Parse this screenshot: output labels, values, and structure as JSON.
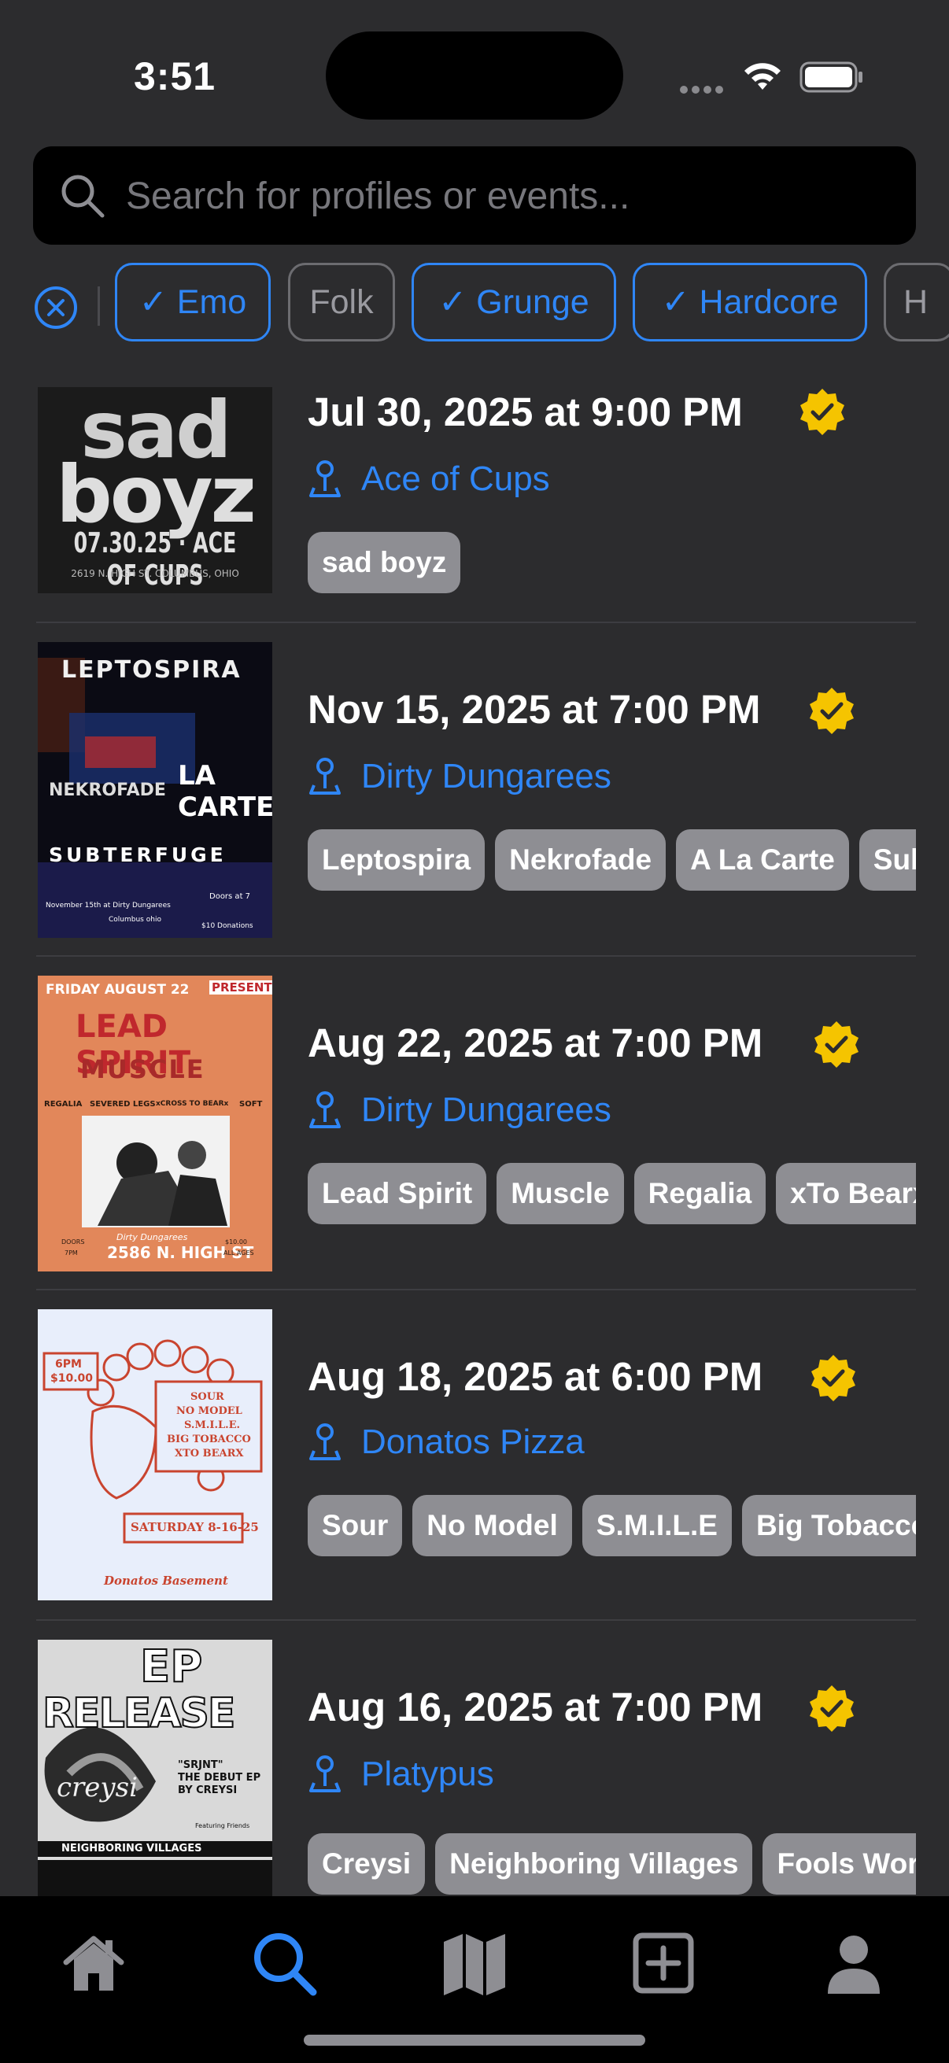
{
  "status_bar": {
    "time": "3:51"
  },
  "search": {
    "placeholder": "Search for profiles or events..."
  },
  "filters": {
    "chips": [
      {
        "label": "✓ Emo",
        "selected": true
      },
      {
        "label": "Folk",
        "selected": false
      },
      {
        "label": "✓ Grunge",
        "selected": true
      },
      {
        "label": "✓ Hardcore",
        "selected": true
      },
      {
        "label": "H",
        "selected": false
      }
    ]
  },
  "events": [
    {
      "date": "Jul 30, 2025 at 9:00 PM",
      "venue": "Ace of Cups",
      "verified": true,
      "performers": [
        "sad boyz"
      ],
      "poster_text": [
        "sad",
        "boyz",
        "07.30.25 · ACE OF CUPS",
        "2619 N. HIGH ST. COLUMBUS, OHIO"
      ]
    },
    {
      "date": "Nov 15, 2025 at 7:00 PM",
      "venue": "Dirty Dungarees",
      "verified": true,
      "performers": [
        "Leptospira",
        "Nekrofade",
        "A La Carte",
        "Subterfuge"
      ],
      "poster_text": [
        "LEPTOSPIRA",
        "NEKROFADE",
        "LA CARTE",
        "SUBTERFUGE",
        "November 15th at Dirty Dungarees",
        "Doors at 7",
        "Columbus ohio",
        "$10 Donations"
      ]
    },
    {
      "date": "Aug 22, 2025 at 7:00 PM",
      "venue": "Dirty Dungarees",
      "verified": true,
      "performers": [
        "Lead Spirit",
        "Muscle",
        "Regalia",
        "xTo Bearx"
      ],
      "poster_text": [
        "FRIDAY AUGUST 22",
        "PRESENTS",
        "LEAD SPIRIT",
        "MUSCLE",
        "REGALIA",
        "SEVERED LEGS",
        "xCROSS TO BEARx",
        "SOFT",
        "DOORS",
        "7PM",
        "Dirty Dungarees",
        "2586 N. HIGH ST",
        "$10.00",
        "ALL AGES"
      ]
    },
    {
      "date": "Aug 18, 2025 at 6:00 PM",
      "venue": "Donatos Pizza",
      "verified": true,
      "performers": [
        "Sour",
        "No Model",
        "S.M.I.L.E",
        "Big Tobacco"
      ],
      "poster_text": [
        "6PM",
        "$10.00",
        "SOUR",
        "NO MODEL",
        "S.M.I.L.E.",
        "BIG TOBACCO",
        "XTO BEARX",
        "SATURDAY 8-16-25",
        "Donatos Basement"
      ]
    },
    {
      "date": "Aug 16, 2025 at 7:00 PM",
      "venue": "Platypus",
      "verified": true,
      "performers": [
        "Creysi",
        "Neighboring Villages",
        "Fools World"
      ],
      "poster_text": [
        "EP",
        "RELEASE",
        "creysi",
        "\"SRJNT\"",
        "THE DEBUT EP",
        "BY CREYSI",
        "Featuring Friends",
        "NEIGHBORING VILLAGES"
      ]
    }
  ],
  "tab_bar": {
    "tabs": [
      {
        "icon": "home-icon",
        "active": false
      },
      {
        "icon": "search-icon",
        "active": true
      },
      {
        "icon": "map-icon",
        "active": false
      },
      {
        "icon": "plus-square-icon",
        "active": false
      },
      {
        "icon": "profile-icon",
        "active": false
      }
    ]
  },
  "colors": {
    "accent": "#2f86f6",
    "background": "#2c2c2e",
    "verified": "#f5c400",
    "tag": "#8e8e93"
  }
}
